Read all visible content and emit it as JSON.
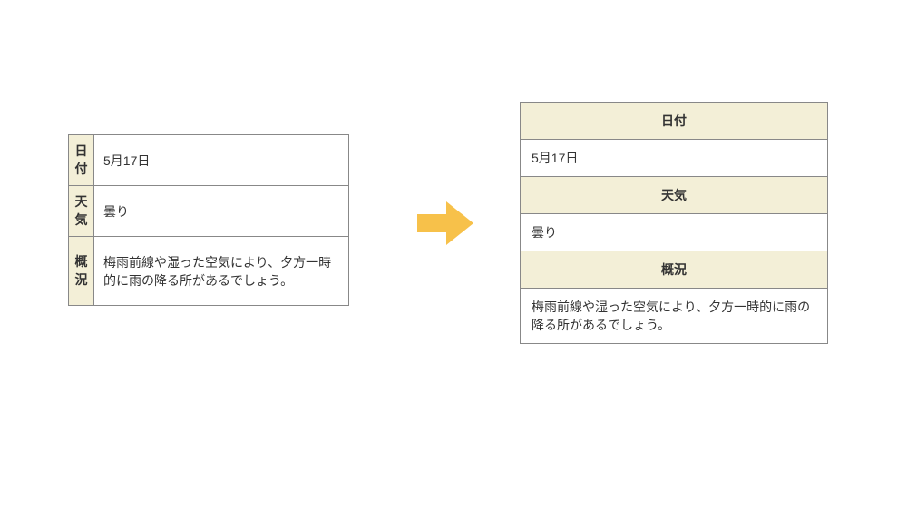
{
  "rows": [
    {
      "label": "日付",
      "value": "5月17日"
    },
    {
      "label": "天気",
      "value": "曇り"
    },
    {
      "label": "概況",
      "value": "梅雨前線や湿った空気により、夕方一時的に雨の降る所があるでしょう。"
    }
  ],
  "colors": {
    "header_bg": "#f3efd7",
    "arrow": "#f7c14a"
  }
}
